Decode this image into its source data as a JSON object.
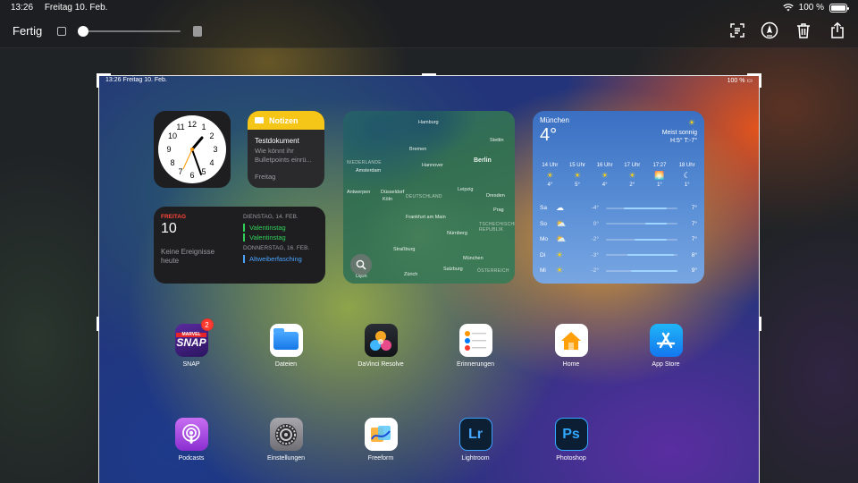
{
  "status_bar": {
    "time": "13:26",
    "date": "Freitag 10. Feb.",
    "battery": "100 %"
  },
  "toolbar": {
    "done_label": "Fertig",
    "opacity_level": 0.02,
    "tools": [
      "scan-text-icon",
      "markup-pen-icon",
      "trash-icon",
      "share-icon"
    ]
  },
  "screenshot": {
    "status": {
      "time_date": "13:26  Freitag 10. Feb.",
      "battery": "100 %"
    },
    "notes_widget": {
      "title": "Notizen",
      "doc_title": "Testdokument",
      "doc_preview": "Wie könnt ihr Bulletpoints einrü...",
      "date": "Freitag"
    },
    "calendar_widget": {
      "day": "FREITAG",
      "date_num": "10",
      "no_events": "Keine Ereignisse heute",
      "upcoming": [
        {
          "header": "DIENSTAG, 14. FEB.",
          "events": [
            "Valentinstag",
            "Valentinstag"
          ]
        },
        {
          "header": "DONNERSTAG, 16. FEB.",
          "events": [
            "Altweiberfasching"
          ]
        }
      ]
    },
    "map_widget": {
      "labels": [
        "Hamburg",
        "Stettin",
        "Bremen",
        "Berlin",
        "Hannover",
        "Amsterdam",
        "NIEDERLANDE",
        "Antwerpen",
        "Düsseldorf",
        "Köln",
        "Leipzig",
        "Dresden",
        "DEUTSCHLAND",
        "Frankfurt am Main",
        "TSCHECHISCHE REPUBLIK",
        "Prag",
        "Nürnberg",
        "Straßburg",
        "München",
        "Salzburg",
        "Zürich",
        "ÖSTERREICH",
        "Dijon"
      ]
    },
    "weather_widget": {
      "city": "München",
      "temp": "4°",
      "condition": "Meist sonnig",
      "hilo": "H:5° T:-7°",
      "hourly": [
        {
          "time": "14 Uhr",
          "icon": "sun-icon",
          "temp": "4°"
        },
        {
          "time": "15 Uhr",
          "icon": "sun-icon",
          "temp": "5°"
        },
        {
          "time": "16 Uhr",
          "icon": "sun-icon",
          "temp": "4°"
        },
        {
          "time": "17 Uhr",
          "icon": "sun-icon",
          "temp": "2°"
        },
        {
          "time": "17:27",
          "icon": "sunset-icon",
          "temp": "1°"
        },
        {
          "time": "18 Uhr",
          "icon": "moon-icon",
          "temp": "1°"
        }
      ],
      "daily": [
        {
          "day": "Sa",
          "icon": "cloud-icon",
          "lo": "-4°",
          "hi": "7°",
          "range": [
            0.25,
            0.85
          ]
        },
        {
          "day": "So",
          "icon": "partly-cloudy-icon",
          "lo": "0°",
          "hi": "7°",
          "range": [
            0.55,
            0.85
          ]
        },
        {
          "day": "Mo",
          "icon": "partly-cloudy-icon",
          "lo": "-2°",
          "hi": "7°",
          "range": [
            0.4,
            0.85
          ]
        },
        {
          "day": "Di",
          "icon": "sun-icon",
          "lo": "-3°",
          "hi": "8°",
          "range": [
            0.3,
            0.95
          ]
        },
        {
          "day": "Mi",
          "icon": "sun-icon",
          "lo": "-2°",
          "hi": "9°",
          "range": [
            0.35,
            1.0
          ]
        }
      ]
    },
    "apps_row1": [
      {
        "name": "SNAP",
        "badge": "2"
      },
      {
        "name": "Dateien"
      },
      {
        "name": "DaVinci Resolve"
      },
      {
        "name": "Erinnerungen"
      },
      {
        "name": "Home"
      },
      {
        "name": "App Store"
      }
    ],
    "apps_row2": [
      {
        "name": "Podcasts"
      },
      {
        "name": "Einstellungen"
      },
      {
        "name": "Freeform"
      },
      {
        "name": "Lightroom",
        "glyph": "Lr"
      },
      {
        "name": "Photoshop",
        "glyph": "Ps"
      }
    ],
    "snap_logo_text": "SNAP",
    "snap_brand": "MARVEL"
  }
}
